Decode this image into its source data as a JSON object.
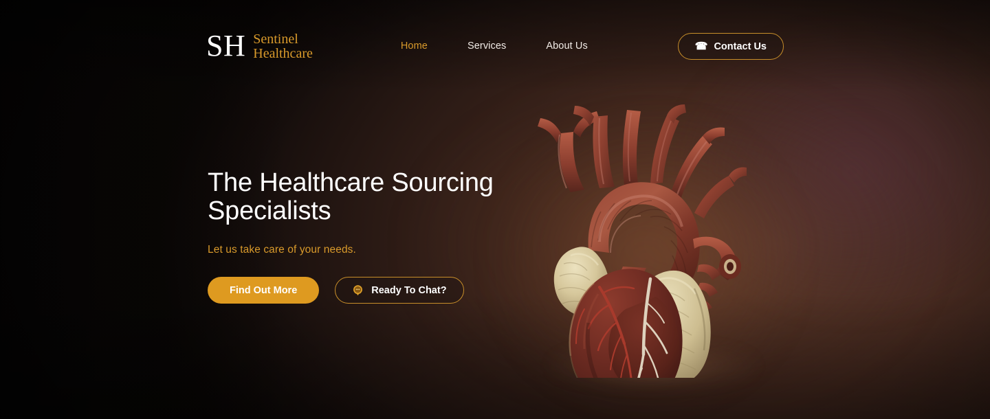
{
  "brand": {
    "monogram": "SH",
    "name_line1": "Sentinel",
    "name_line2": "Healthcare",
    "accent_color": "#d99a2b"
  },
  "nav": {
    "items": [
      {
        "label": "Home",
        "active": true
      },
      {
        "label": "Services",
        "active": false
      },
      {
        "label": "About Us",
        "active": false
      }
    ],
    "contact_button": {
      "label": "Contact Us",
      "icon": "telephone-icon",
      "icon_glyph": "☎"
    }
  },
  "hero": {
    "headline": "The Healthcare Sourcing\nSpecialists",
    "subheadline": "Let us take care of your needs.",
    "primary_button": {
      "label": "Find Out More",
      "bg_color": "#de9a20"
    },
    "secondary_button": {
      "label": "Ready To Chat?",
      "icon": "chat-bubble-icon",
      "border_color": "#c98f2a"
    },
    "illustration": "anatomical-heart-image"
  },
  "theme": {
    "background": "#2e1c16",
    "accent": "#d99a2b",
    "text_light": "#ffffff"
  }
}
